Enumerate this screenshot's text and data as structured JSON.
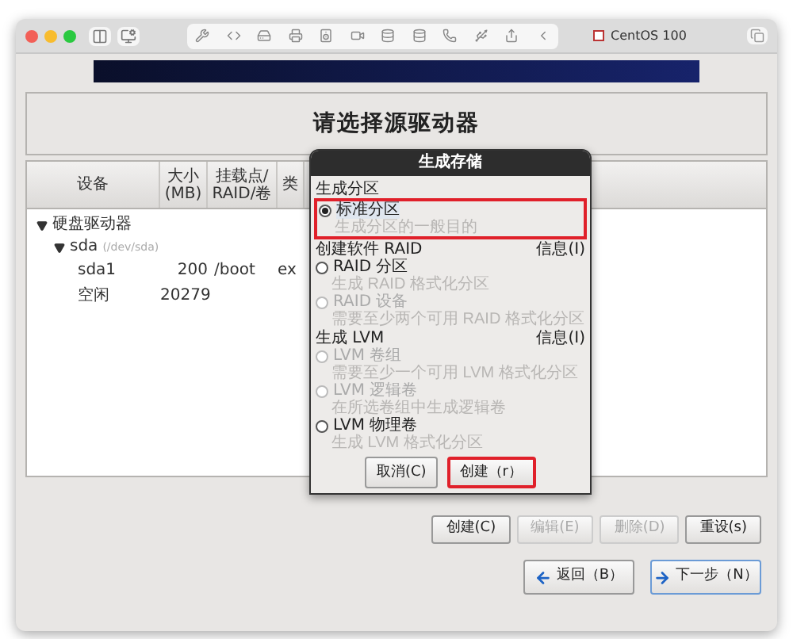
{
  "window": {
    "title": "CentOS 100"
  },
  "installer": {
    "heading": "请选择源驱动器",
    "table": {
      "columns": [
        "设备",
        "大小\n(MB)",
        "挂载点/\nRAID/卷",
        "类"
      ],
      "tree": [
        {
          "label": "硬盘驱动器",
          "expanded": true,
          "children": [
            {
              "label": "sda",
              "sublabel": "(/dev/sda)",
              "expanded": true,
              "children": [
                {
                  "label": "sda1",
                  "size": "200",
                  "mount": "/boot",
                  "column_4": "ex"
                },
                {
                  "label": "空闲",
                  "size": "20279"
                }
              ]
            }
          ]
        }
      ]
    },
    "actions": [
      {
        "label": "创建(C)",
        "disabled": false
      },
      {
        "label": "编辑(E)",
        "disabled": true
      },
      {
        "label": "删除(D)",
        "disabled": true
      },
      {
        "label": "重设(s)",
        "disabled": false
      }
    ],
    "nav": [
      {
        "label": "返回（B）",
        "kind": "back",
        "default": false
      },
      {
        "label": "下一步（N）",
        "kind": "next",
        "default": true
      }
    ]
  },
  "dialog": {
    "title": "生成存储",
    "sections": [
      {
        "heading": "生成分区",
        "options": [
          {
            "label": "标准分区",
            "description": "生成分区的一般目的",
            "selected": true,
            "disabled": false,
            "highlighted": true
          }
        ]
      },
      {
        "heading": "创建软件 RAID",
        "info": "信息(I)",
        "options": [
          {
            "label": "RAID 分区",
            "description": "生成 RAID 格式化分区",
            "selected": false,
            "disabled": false,
            "highlighted": false
          },
          {
            "label": "RAID 设备",
            "description": "需要至少两个可用 RAID 格式化分区",
            "selected": false,
            "disabled": true,
            "highlighted": false
          }
        ]
      },
      {
        "heading": "生成 LVM",
        "info": "信息(I)",
        "options": [
          {
            "label": "LVM 卷组",
            "description": "需要至少一个可用 LVM 格式化分区",
            "selected": false,
            "disabled": true,
            "highlighted": false
          },
          {
            "label": "LVM 逻辑卷",
            "description": "在所选卷组中生成逻辑卷",
            "selected": false,
            "disabled": true,
            "highlighted": false
          },
          {
            "label": "LVM 物理卷",
            "description": "生成 LVM 格式化分区",
            "selected": false,
            "disabled": false,
            "highlighted": false
          }
        ]
      }
    ],
    "buttons": [
      {
        "label": "取消(C)",
        "highlighted": false
      },
      {
        "label": "创建（r）",
        "highlighted": true
      }
    ]
  }
}
